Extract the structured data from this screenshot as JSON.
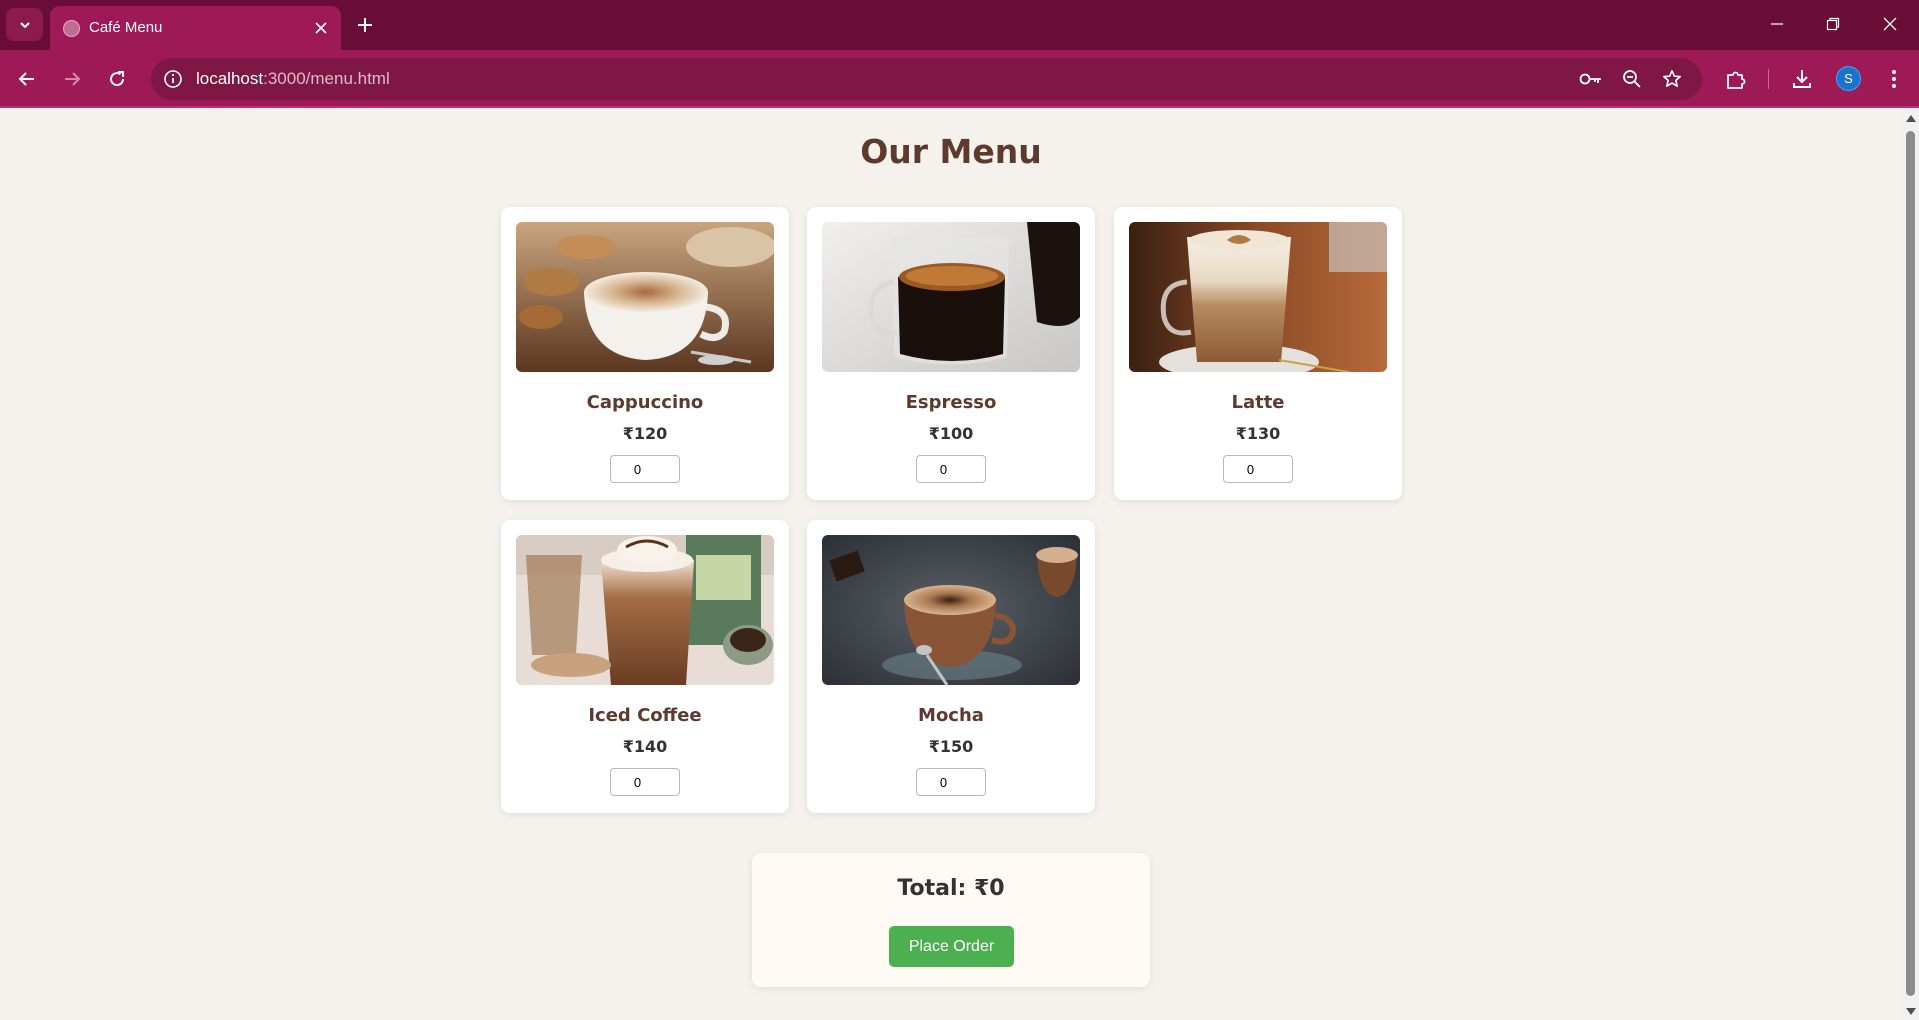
{
  "browser": {
    "tab_title": "Café Menu",
    "url_host": "localhost",
    "url_path": ":3000/menu.html",
    "profile_initial": "S",
    "icons": [
      "tab-list-icon",
      "globe-icon",
      "close-icon",
      "plus-icon",
      "minimize-icon",
      "restore-icon",
      "window-close-icon",
      "back-icon",
      "forward-icon",
      "reload-icon",
      "site-info-icon",
      "key-icon",
      "zoom-icon",
      "star-icon",
      "extensions-icon",
      "download-icon",
      "more-icon"
    ]
  },
  "page": {
    "title": "Our Menu"
  },
  "menu": {
    "items": [
      {
        "name": "Cappuccino",
        "price": "₹120",
        "qty": "0",
        "image": "cappuccino-photo"
      },
      {
        "name": "Espresso",
        "price": "₹100",
        "qty": "0",
        "image": "espresso-photo"
      },
      {
        "name": "Latte",
        "price": "₹130",
        "qty": "0",
        "image": "latte-photo"
      },
      {
        "name": "Iced Coffee",
        "price": "₹140",
        "qty": "0",
        "image": "iced-coffee-photo"
      },
      {
        "name": "Mocha",
        "price": "₹150",
        "qty": "0",
        "image": "mocha-photo"
      }
    ]
  },
  "order": {
    "total_text": "Total: ₹0",
    "button_label": "Place Order"
  },
  "colors": {
    "tabbar": "#6a0d36",
    "toolbar": "#9e1a56",
    "page_bg": "#f5f1ec",
    "heading": "#5c3b2e",
    "order_button": "#4caf50"
  }
}
